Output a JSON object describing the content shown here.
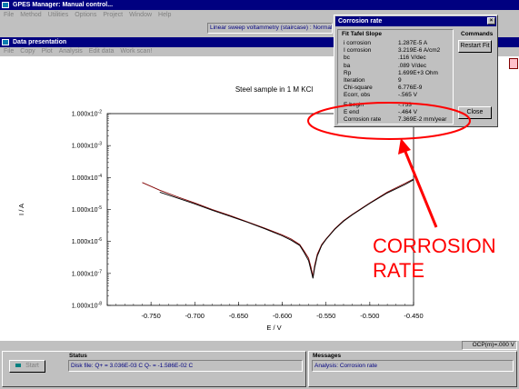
{
  "app": {
    "title": "GPES Manager: Manual control...",
    "menu": [
      "File",
      "Method",
      "Utilities",
      "Options",
      "Project",
      "Window",
      "Help"
    ],
    "procedure": "Linear sweep voltammetry (staircase) : Normal"
  },
  "toolbar": {
    "icons": [
      "open-icon",
      "save-icon",
      "print-icon",
      "cut-icon",
      "copy-icon",
      "paste-icon",
      "graph-icon",
      "help-icon"
    ]
  },
  "data_window": {
    "title": "Data presentation",
    "menu": [
      "File",
      "Copy",
      "Plot",
      "Analysis",
      "Edit data",
      "Work scan!"
    ]
  },
  "chart_data": {
    "type": "line",
    "title": "Steel sample in 1 M KCl",
    "xlabel": "E / V",
    "ylabel": "I / A",
    "y_scale": "log",
    "xlim": [
      -0.8,
      -0.45
    ],
    "ylim": [
      1e-08,
      0.01
    ],
    "x_ticks": [
      "-0.750",
      "-0.700",
      "-0.650",
      "-0.600",
      "-0.550",
      "-0.500",
      "-0.450"
    ],
    "y_ticks": [
      "1.000x10^-2",
      "1.000x10^-3",
      "1.000x10^-4",
      "1.000x10^-5",
      "1.000x10^-6",
      "1.000x10^-7",
      "1.000x10^-8"
    ],
    "series": [
      {
        "color": "#800000",
        "x": [
          -0.76,
          -0.74,
          -0.72,
          -0.7,
          -0.68,
          -0.66,
          -0.64,
          -0.62,
          -0.6,
          -0.59,
          -0.58,
          -0.575,
          -0.57,
          -0.567,
          -0.565,
          -0.563,
          -0.56,
          -0.555,
          -0.55,
          -0.54,
          -0.53,
          -0.52,
          -0.5,
          -0.48,
          -0.46,
          -0.45
        ],
        "y": [
          7e-05,
          4e-05,
          2.5e-05,
          1.6e-05,
          1e-05,
          6.5e-06,
          4.1e-06,
          2.6e-06,
          1.6e-06,
          1.2e-06,
          8e-07,
          5e-07,
          3e-07,
          1.5e-07,
          8e-08,
          1.8e-07,
          4e-07,
          8e-07,
          1.2e-06,
          2.5e-06,
          4.5e-06,
          7e-06,
          1.6e-05,
          3.5e-05,
          6.5e-05,
          9e-05
        ]
      },
      {
        "color": "#000000",
        "x": [
          -0.74,
          -0.72,
          -0.7,
          -0.68,
          -0.66,
          -0.64,
          -0.62,
          -0.6,
          -0.59,
          -0.58,
          -0.575,
          -0.57,
          -0.567,
          -0.565,
          -0.563,
          -0.56,
          -0.555,
          -0.55,
          -0.54,
          -0.53,
          -0.52,
          -0.5,
          -0.48,
          -0.46,
          -0.45
        ],
        "y": [
          3.5e-05,
          2.3e-05,
          1.5e-05,
          9.5e-06,
          6.2e-06,
          4e-06,
          2.5e-06,
          1.5e-06,
          1.1e-06,
          7.5e-07,
          4.5e-07,
          2.5e-07,
          1.2e-07,
          7e-08,
          1.5e-07,
          3.5e-07,
          7.5e-07,
          1.15e-06,
          2.4e-06,
          4.3e-06,
          6.8e-06,
          1.55e-05,
          3.3e-05,
          6e-05,
          8.5e-05
        ]
      }
    ]
  },
  "corrosion_window": {
    "title": "Corrosion rate",
    "section": "Fit Tafel Slope",
    "commands_label": "Commands",
    "restart_label": "Restart Fit",
    "close_label": "Close",
    "rows": [
      {
        "key": "i corrosion",
        "value": "1.287E-5 A"
      },
      {
        "key": "I corrosion",
        "value": "3.219E-6 A/cm2"
      },
      {
        "key": "bc",
        "value": ".116 V/dec"
      },
      {
        "key": "ba",
        "value": ".089 V/dec"
      },
      {
        "key": "Rp",
        "value": "1.699E+3 Ohm"
      },
      {
        "key": "Iteration",
        "value": "9"
      },
      {
        "key": "Chi-square",
        "value": "6.776E-9"
      },
      {
        "key": "Ecorr, obs",
        "value": "-.565 V"
      }
    ],
    "rows2": [
      {
        "key": "E begin",
        "value": "-.753"
      },
      {
        "key": "E end",
        "value": "-.464 V"
      },
      {
        "key": "Corrosion rate",
        "value": "7.369E-2 mm/year"
      }
    ]
  },
  "annotation": {
    "line1": "CORROSION",
    "line2": "RATE",
    "color": "#ff0000"
  },
  "ocp": "OCP(m)=.000 V",
  "status": {
    "label": "Status",
    "start_label": "Start",
    "text": "Disk file:  Q+ = 3.036E-03 C  Q- = -1.586E-02 C"
  },
  "messages": {
    "label": "Messages",
    "text": "Analysis: Corrosion rate"
  }
}
